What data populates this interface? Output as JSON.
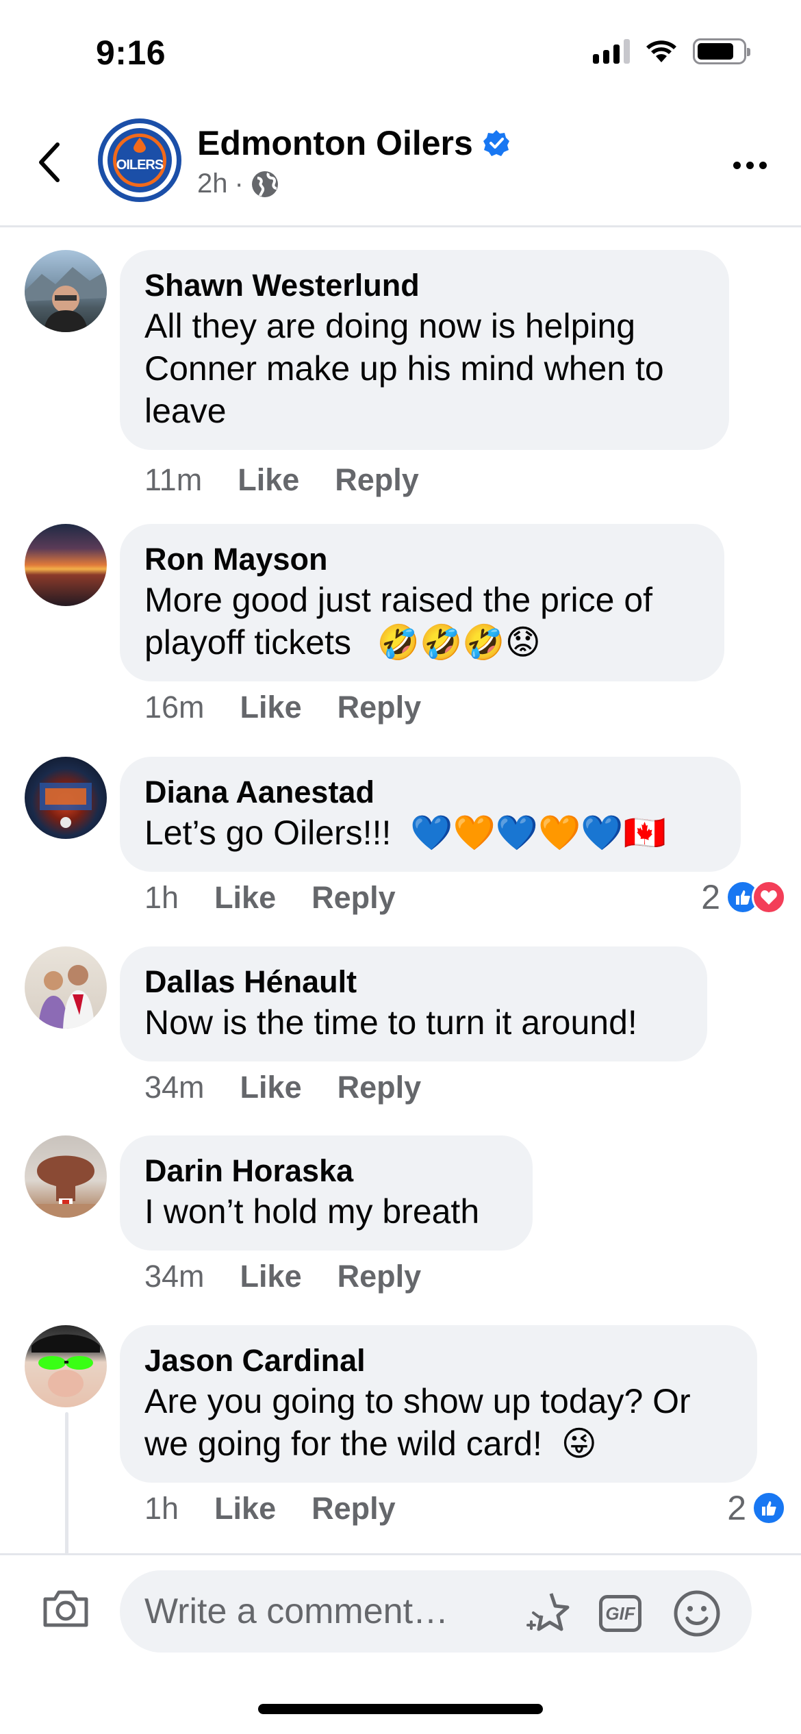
{
  "status_bar": {
    "time": "9:16"
  },
  "header": {
    "page_name": "Edmonton Oilers",
    "avatar_text": "OILERS",
    "time_ago": "2h",
    "separator": "·"
  },
  "comments": [
    {
      "author": "Shawn Westerlund",
      "lines": [
        "All they are doing now is helping",
        "Conner make up his mind when to",
        "leave"
      ],
      "time": "11m",
      "like": "Like",
      "reply": "Reply",
      "reaction_count": "",
      "emojis": ""
    },
    {
      "author": "Ron Mayson",
      "lines": [
        "More good just raised the price of"
      ],
      "line2_text": "playoff tickets",
      "emojis": "🤣🤣🤣😟",
      "time": "16m",
      "like": "Like",
      "reply": "Reply",
      "reaction_count": ""
    },
    {
      "author": "Diana Aanestad",
      "text": "Let’s go Oilers!!!",
      "emojis": "💙🧡💙🧡💙🇨🇦",
      "time": "1h",
      "like": "Like",
      "reply": "Reply",
      "reaction_count": "2"
    },
    {
      "author": "Dallas Hénault",
      "text": "Now is the time to turn it around!",
      "time": "34m",
      "like": "Like",
      "reply": "Reply",
      "reaction_count": ""
    },
    {
      "author": "Darin Horaska",
      "text": "I won’t hold my breath",
      "time": "34m",
      "like": "Like",
      "reply": "Reply",
      "reaction_count": ""
    },
    {
      "author": "Jason Cardinal",
      "lines": [
        "Are you going to show up today? Or"
      ],
      "line2_text": "we going for the wild card!",
      "emojis": "😜",
      "time": "1h",
      "like": "Like",
      "reply": "Reply",
      "reaction_count": "2"
    }
  ],
  "composer": {
    "placeholder": "Write a comment…",
    "gif_label": "GIF"
  },
  "colors": {
    "facebook_blue": "#1877f2",
    "love_red": "#f33e58",
    "bubble_gray": "#f0f2f5",
    "secondary_text": "#65676b",
    "oilers_blue": "#1b4fa8",
    "oilers_orange": "#f26a1b"
  }
}
